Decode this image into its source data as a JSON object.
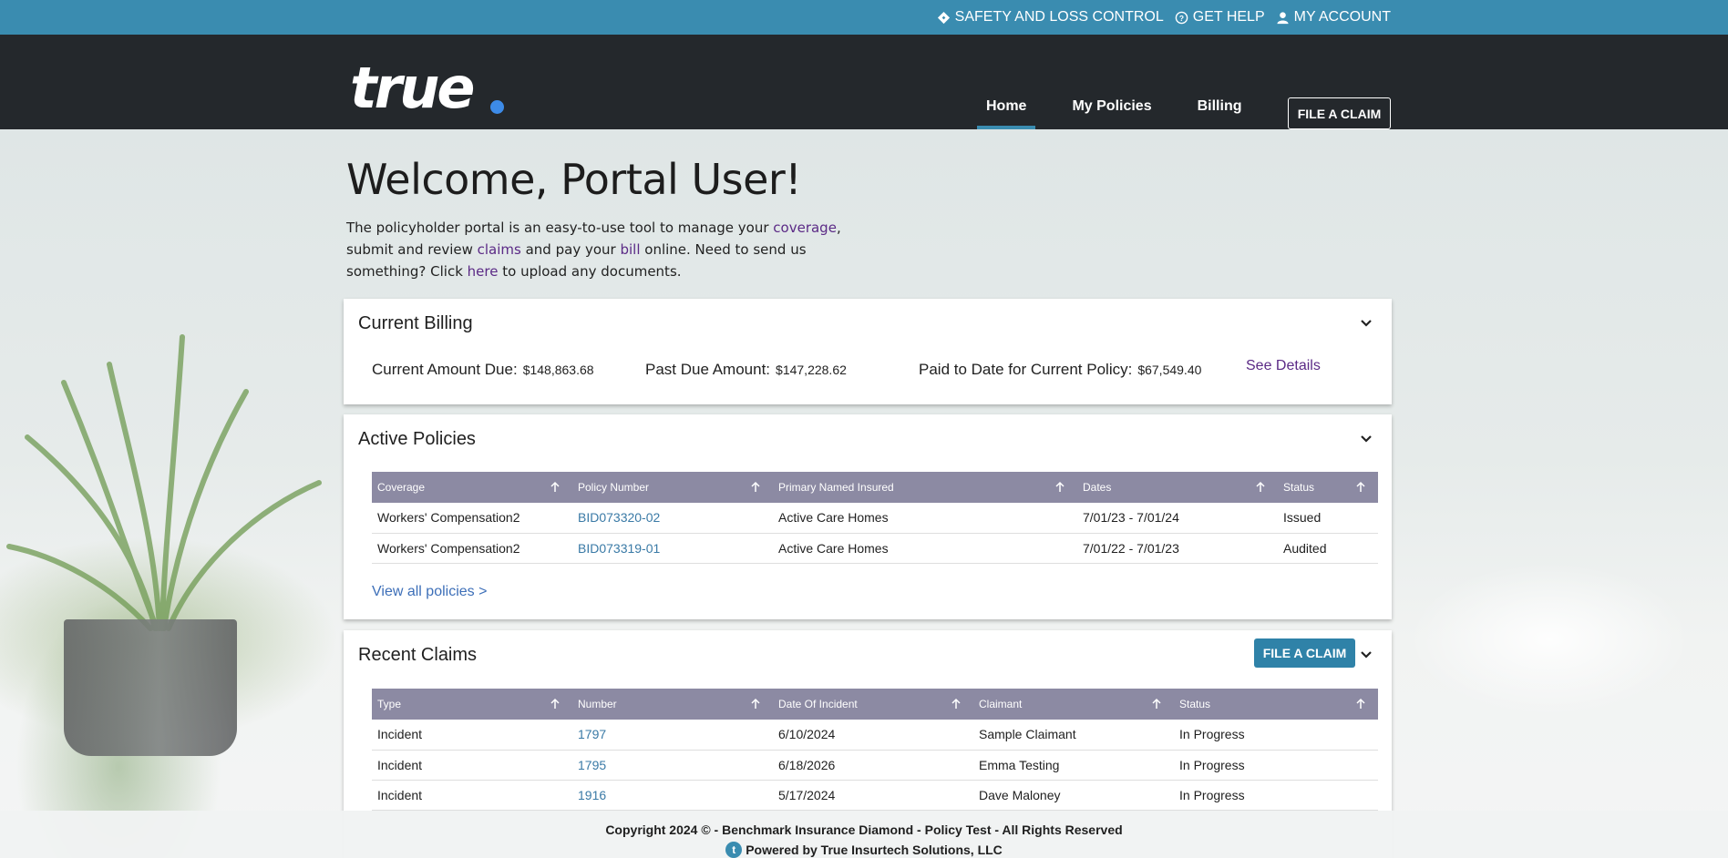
{
  "topbar": {
    "links": [
      {
        "label": "SAFETY AND LOSS CONTROL",
        "icon": "diamond-icon"
      },
      {
        "label": "GET HELP",
        "icon": "help-circle-icon"
      },
      {
        "label": "MY ACCOUNT",
        "icon": "user-icon"
      }
    ]
  },
  "header": {
    "logo": "true",
    "nav": [
      {
        "label": "Home",
        "active": true
      },
      {
        "label": "My Policies",
        "active": false
      },
      {
        "label": "Billing",
        "active": false
      }
    ],
    "file_claim_label": "FILE A CLAIM"
  },
  "welcome": {
    "title": "Welcome, Portal User!",
    "text_1": "The policyholder portal is an easy-to-use tool to manage your ",
    "link_coverage": "coverage",
    "text_2": ",",
    "text_3": "submit and review ",
    "link_claims": "claims",
    "text_4": " and pay your ",
    "link_bill": "bill",
    "text_5": " online. Need to send us",
    "text_6": "something? Click ",
    "link_here": "here",
    "text_7": " to upload any documents."
  },
  "billing": {
    "title": "Current Billing",
    "current_due_label": "Current Amount Due:",
    "current_due_value": "$148,863.68",
    "past_due_label": "Past Due Amount:",
    "past_due_value": "$147,228.62",
    "paid_label": "Paid to Date for Current Policy:",
    "paid_value": "$67,549.40",
    "see_details": "See Details"
  },
  "policies": {
    "title": "Active Policies",
    "columns": [
      "Coverage",
      "Policy Number",
      "Primary Named Insured",
      "Dates",
      "Status"
    ],
    "rows": [
      [
        "Workers' Compensation2",
        "BID073320-02",
        "Active Care Homes",
        "7/01/23 - 7/01/24",
        "Issued"
      ],
      [
        "Workers' Compensation2",
        "BID073319-01",
        "Active Care Homes",
        "7/01/22 - 7/01/23",
        "Audited"
      ]
    ],
    "view_all": "View all policies >"
  },
  "claims": {
    "title": "Recent Claims",
    "file_claim_label": "FILE A CLAIM",
    "columns": [
      "Type",
      "Number",
      "Date Of Incident",
      "Claimant",
      "Status"
    ],
    "rows": [
      [
        "Incident",
        "1797",
        "6/10/2024",
        "Sample Claimant",
        "In Progress"
      ],
      [
        "Incident",
        "1795",
        "6/18/2026",
        "Emma Testing",
        "In Progress"
      ],
      [
        "Incident",
        "1916",
        "5/17/2024",
        "Dave Maloney",
        "In Progress"
      ]
    ]
  },
  "footer": {
    "copyright": "Copyright 2024 © - Benchmark Insurance Diamond - Policy Test - All Rights Reserved",
    "powered": "Powered by True Insurtech Solutions, LLC"
  },
  "colors": {
    "topbar": "#3a8cb0",
    "header": "#24282c",
    "table_header": "#8c8aa3",
    "link_purple": "#5b2a86",
    "link_blue": "#3a7aa6",
    "button": "#2f82a8"
  }
}
